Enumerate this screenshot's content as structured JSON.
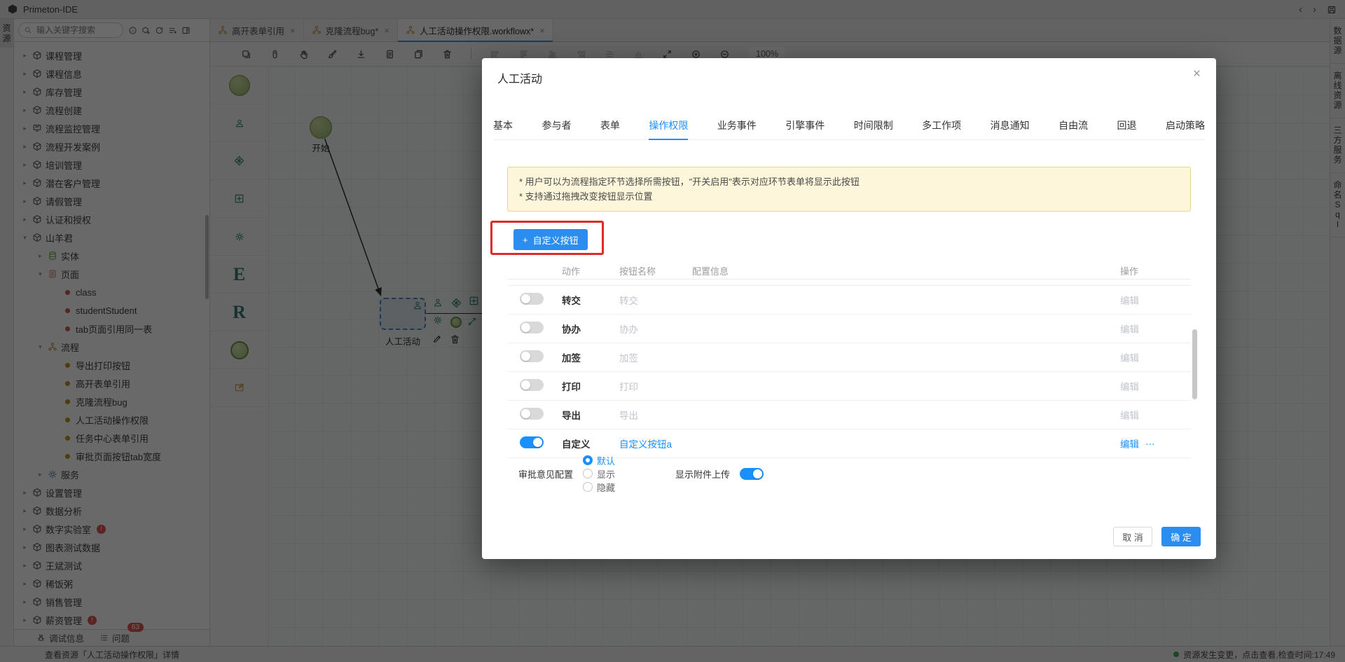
{
  "window": {
    "title": "Primeton-IDE",
    "nav_back": "‹",
    "nav_forward": "›"
  },
  "left_rail": {
    "active_tab": "资源"
  },
  "sidebar": {
    "search_placeholder": "输入关键字搜索",
    "action_icons": [
      "ai-icon",
      "cube-plus-icon",
      "refresh-icon",
      "list-icon",
      "panel-icon"
    ],
    "tree": [
      {
        "label": "课程管理",
        "depth": 0,
        "icon": "package-icon",
        "caret": "collapsed"
      },
      {
        "label": "课程信息",
        "depth": 0,
        "icon": "package-icon",
        "caret": "collapsed"
      },
      {
        "label": "库存管理",
        "depth": 0,
        "icon": "package-icon",
        "caret": "collapsed"
      },
      {
        "label": "流程创建",
        "depth": 0,
        "icon": "package-icon",
        "caret": "collapsed"
      },
      {
        "label": "流程监控管理",
        "depth": 0,
        "icon": "monitor-icon",
        "caret": "collapsed"
      },
      {
        "label": "流程开发案例",
        "depth": 0,
        "icon": "package-icon",
        "caret": "collapsed"
      },
      {
        "label": "培训管理",
        "depth": 0,
        "icon": "package-icon",
        "caret": "collapsed"
      },
      {
        "label": "潜在客户管理",
        "depth": 0,
        "icon": "package-icon",
        "caret": "collapsed"
      },
      {
        "label": "请假管理",
        "depth": 0,
        "icon": "package-icon",
        "caret": "collapsed"
      },
      {
        "label": "认证和授权",
        "depth": 0,
        "icon": "package-icon",
        "caret": "collapsed"
      },
      {
        "label": "山羊君",
        "depth": 0,
        "icon": "package-icon",
        "caret": "expanded"
      },
      {
        "label": "实体",
        "depth": 1,
        "icon": "database-icon",
        "caret": "collapsed"
      },
      {
        "label": "页面",
        "depth": 1,
        "icon": "page-icon",
        "caret": "expanded"
      },
      {
        "label": "class",
        "depth": 2,
        "icon": "bullet-red",
        "caret": "none"
      },
      {
        "label": "studentStudent",
        "depth": 2,
        "icon": "bullet-red",
        "caret": "none"
      },
      {
        "label": "tab页面引用同一表",
        "depth": 2,
        "icon": "bullet-red",
        "caret": "none"
      },
      {
        "label": "流程",
        "depth": 1,
        "icon": "flow-icon",
        "caret": "expanded"
      },
      {
        "label": "导出打印按钮",
        "depth": 2,
        "icon": "bullet-orange",
        "caret": "none"
      },
      {
        "label": "高开表单引用",
        "depth": 2,
        "icon": "bullet-orange",
        "caret": "none"
      },
      {
        "label": "克隆流程bug",
        "depth": 2,
        "icon": "bullet-orange",
        "caret": "none"
      },
      {
        "label": "人工活动操作权限",
        "depth": 2,
        "icon": "bullet-orange",
        "caret": "none"
      },
      {
        "label": "任务中心表单引用",
        "depth": 2,
        "icon": "bullet-orange",
        "caret": "none"
      },
      {
        "label": "审批页面按钮tab宽度",
        "depth": 2,
        "icon": "bullet-orange",
        "caret": "none"
      },
      {
        "label": "服务",
        "depth": 1,
        "icon": "gear-blue-icon",
        "caret": "collapsed"
      },
      {
        "label": "设置管理",
        "depth": 0,
        "icon": "package-icon",
        "caret": "collapsed"
      },
      {
        "label": "数据分析",
        "depth": 0,
        "icon": "package-icon",
        "caret": "collapsed"
      },
      {
        "label": "数字实验室",
        "depth": 0,
        "icon": "package-icon",
        "caret": "collapsed",
        "badge": "!"
      },
      {
        "label": "图表测试数据",
        "depth": 0,
        "icon": "package-icon",
        "caret": "collapsed"
      },
      {
        "label": "王斌测试",
        "depth": 0,
        "icon": "package-icon",
        "caret": "collapsed"
      },
      {
        "label": "稀饭粥",
        "depth": 0,
        "icon": "package-icon",
        "caret": "collapsed"
      },
      {
        "label": "销售管理",
        "depth": 0,
        "icon": "package-icon",
        "caret": "collapsed"
      },
      {
        "label": "薪资管理",
        "depth": 0,
        "icon": "package-icon",
        "caret": "collapsed",
        "badge": "!"
      }
    ],
    "footer": {
      "debug_label": "调试信息",
      "problems_label": "问题",
      "problems_badge": "63"
    }
  },
  "editor_tabs": [
    {
      "label": "高开表单引用",
      "icon": "flow-icon",
      "active": false,
      "close": "×"
    },
    {
      "label": "克隆流程bug*",
      "icon": "flow-icon",
      "active": false,
      "close": "×"
    },
    {
      "label": "人工活动操作权限.workflowx*",
      "icon": "flow-icon",
      "active": true,
      "close": "×"
    }
  ],
  "canvas_toolbar": {
    "zoom_level": "100%",
    "icons": [
      {
        "name": "copy-icon"
      },
      {
        "name": "pointer-icon"
      },
      {
        "name": "hand-icon"
      },
      {
        "name": "brush-icon"
      },
      {
        "name": "download-icon"
      },
      {
        "name": "file-icon"
      },
      {
        "name": "files-icon"
      },
      {
        "name": "trash-icon"
      },
      {
        "divider": true
      },
      {
        "name": "align-left-icon",
        "disabled": true
      },
      {
        "name": "align-top-icon",
        "disabled": true
      },
      {
        "name": "align-bottom-icon",
        "disabled": true
      },
      {
        "name": "align-right-icon",
        "disabled": true
      },
      {
        "name": "align-middle-icon",
        "disabled": true
      },
      {
        "name": "chart-bars-icon",
        "disabled": true
      },
      {
        "name": "expand-icon"
      },
      {
        "name": "zoom-in-icon"
      },
      {
        "name": "zoom-out-icon"
      }
    ]
  },
  "palette": {
    "items": [
      {
        "name": "start-node-icon"
      },
      {
        "name": "user-node-icon"
      },
      {
        "name": "diamond-node-icon"
      },
      {
        "name": "subflow-node-icon"
      },
      {
        "name": "gear-node-icon"
      },
      {
        "name": "letter-e-icon",
        "label": "E"
      },
      {
        "name": "letter-r-icon",
        "label": "R"
      },
      {
        "name": "end-node-icon"
      },
      {
        "name": "note-node-icon"
      }
    ]
  },
  "canvas": {
    "start_label": "开始",
    "node_label": "人工活动",
    "context_icons": [
      "user-icon",
      "diamond-icon",
      "subflow-icon",
      "gear-icon",
      "end-circle-icon",
      "connector-icon",
      "pencil-icon",
      "trash-icon"
    ]
  },
  "right_rail": {
    "tabs": [
      "数据源",
      "离线资源",
      "三方服务",
      "命名Sql"
    ]
  },
  "status_bar": {
    "left": "查看资源「人工活动操作权限」详情",
    "right": "资源发生变更，点击查看,检查时间:17:49"
  },
  "modal": {
    "title": "人工活动",
    "close": "×",
    "tabs": [
      {
        "label": "基本"
      },
      {
        "label": "参与者"
      },
      {
        "label": "表单"
      },
      {
        "label": "操作权限",
        "active": true
      },
      {
        "label": "业务事件"
      },
      {
        "label": "引擎事件"
      },
      {
        "label": "时间限制"
      },
      {
        "label": "多工作项"
      },
      {
        "label": "消息通知"
      },
      {
        "label": "自由流"
      },
      {
        "label": "回退"
      },
      {
        "label": "启动策略"
      }
    ],
    "notice_line1": "* 用户可以为流程指定环节选择所需按钮，\"开关启用\"表示对应环节表单将显示此按钮",
    "notice_line2": "* 支持通过拖拽改变按钮显示位置",
    "add_button_plus": "+",
    "add_button_label": "自定义按钮",
    "table": {
      "headers": [
        "动作",
        "按钮名称",
        "配置信息",
        "操作"
      ],
      "rows": [
        {
          "action": "转交",
          "name": "转交",
          "config": "",
          "enabled": false,
          "edit": "编辑"
        },
        {
          "action": "协办",
          "name": "协办",
          "config": "",
          "enabled": false,
          "edit": "编辑"
        },
        {
          "action": "加签",
          "name": "加签",
          "config": "",
          "enabled": false,
          "edit": "编辑"
        },
        {
          "action": "打印",
          "name": "打印",
          "config": "",
          "enabled": false,
          "edit": "编辑"
        },
        {
          "action": "导出",
          "name": "导出",
          "config": "",
          "enabled": false,
          "edit": "编辑"
        },
        {
          "action": "自定义",
          "name": "自定义按钮a",
          "config": "",
          "enabled": true,
          "edit": "编辑",
          "more": "···"
        }
      ]
    },
    "opinion": {
      "label": "审批意见配置",
      "options": [
        {
          "label": "默认",
          "selected": true
        },
        {
          "label": "显示",
          "selected": false
        },
        {
          "label": "隐藏",
          "selected": false
        }
      ]
    },
    "attachment": {
      "label": "显示附件上传",
      "on": true
    },
    "footer": {
      "cancel": "取 消",
      "ok": "确 定"
    }
  },
  "colors": {
    "accent": "#1890ff",
    "annotation_red": "#e02b2b",
    "notice_bg": "#fdf6da",
    "notice_border": "#e7d78b",
    "badge_red": "#d84a4a",
    "node_teal": "#2a7f76",
    "flow_orange": "#c8903c",
    "start_green": "#8fae62"
  }
}
